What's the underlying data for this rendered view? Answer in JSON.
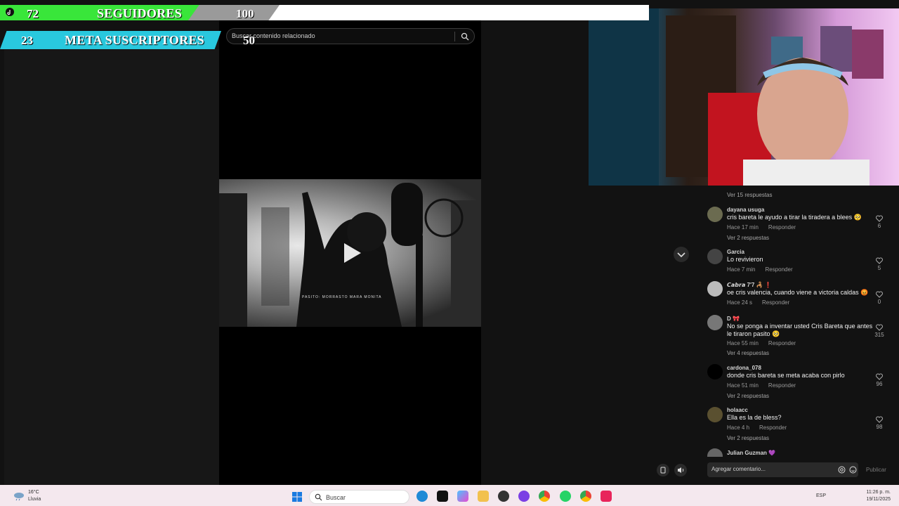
{
  "overlay": {
    "followers_count": "72",
    "followers_label": "SEGUIDORES",
    "followers_goal": "100",
    "subs_count": "23",
    "subs_label": "META SUSCRIPTORES",
    "subs_goal": "50"
  },
  "search": {
    "placeholder": "Buscar contenido relacionado"
  },
  "video": {
    "caption": "PASITO: MORRASTO MARA MONITA"
  },
  "comments": [
    {
      "more": "Ver 15 respuestas"
    },
    {
      "user": "dayana usuga",
      "text": "cris bareta le ayudo a tirar la tiradera a blees 🥺",
      "time": "Hace 17 min",
      "reply": "Responder",
      "likes": "6",
      "more": "Ver 2 respuestas"
    },
    {
      "user": "Garcia",
      "text": "Lo revivieron",
      "time": "Hace 7 min",
      "reply": "Responder",
      "likes": "5"
    },
    {
      "user": "𝘾𝙖𝙗𝙧𝙖 7'7 🦂 ❗",
      "text": "oe cris valencia, cuando viene a victoria caldas 😡",
      "time": "Hace 24 s",
      "reply": "Responder",
      "likes": "0"
    },
    {
      "user": "D 🎀",
      "text": "No se ponga a inventar usted Cris Bareta que antes le tiraron pasito 🥺",
      "time": "Hace 55 min",
      "reply": "Responder",
      "likes": "315",
      "more": "Ver 4 respuestas"
    },
    {
      "user": "cardona_078",
      "text": "donde cris bareta se meta acaba con pirlo",
      "time": "Hace 51 min",
      "reply": "Responder",
      "likes": "96",
      "more": "Ver 2 respuestas"
    },
    {
      "user": "holaacc",
      "text": "Ella es la de bless?",
      "time": "Hace 4 h",
      "reply": "Responder",
      "likes": "98",
      "more": "Ver 2 respuestas"
    },
    {
      "user": "Julian Guzman 💜"
    }
  ],
  "comment_input": {
    "placeholder": "Agregar comentario...",
    "publish": "Publicar"
  },
  "taskbar": {
    "temp": "16°C",
    "condition": "Lluvia",
    "search": "Buscar",
    "lang": "ESP",
    "time": "11:26 p. m.",
    "date": "19/11/2025"
  },
  "colors": {
    "green_bar": "#39e63a",
    "cyan_bar": "#29c8de",
    "gray_bar": "#9a9a9a",
    "background": "#121212"
  }
}
